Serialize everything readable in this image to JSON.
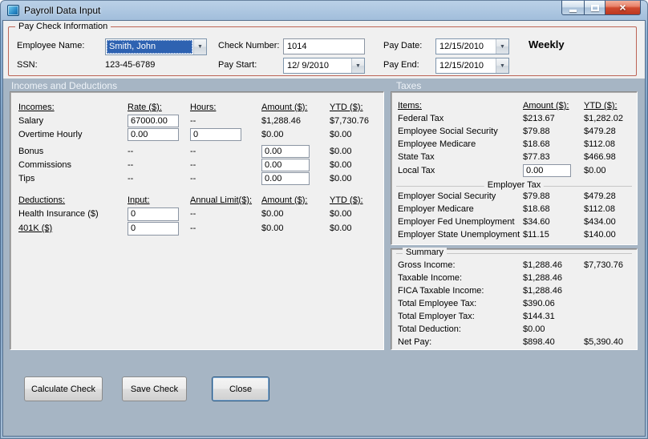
{
  "colors": {
    "selection": "#2e62b1",
    "group_border": "#bc6456",
    "backdrop": "#a6b5c4"
  },
  "icons": {
    "dropdown": "▼"
  },
  "window": {
    "title": "Payroll Data Input"
  },
  "paycheck": {
    "group_label": "Pay Check Information",
    "employee_name_label": "Employee Name:",
    "employee_name_value": "Smith, John",
    "ssn_label": "SSN:",
    "ssn_value": "123-45-6789",
    "check_number_label": "Check Number:",
    "check_number_value": "1014",
    "pay_start_label": "Pay Start:",
    "pay_start_value": "12/ 9/2010",
    "pay_date_label": "Pay Date:",
    "pay_date_value": "12/15/2010",
    "pay_end_label": "Pay End:",
    "pay_end_value": "12/15/2010",
    "frequency": "Weekly"
  },
  "section_headers": {
    "incomes": "Incomes and Deductions",
    "taxes": "Taxes"
  },
  "incomes": {
    "headers": {
      "c1": "Incomes:",
      "c2": "Rate ($):",
      "c3": "Hours:",
      "c4": "Amount ($):",
      "c5": "YTD ($):"
    },
    "salary": {
      "label": "Salary",
      "rate": "67000.00",
      "hours": "--",
      "amount": "$1,288.46",
      "ytd": "$7,730.76"
    },
    "overtime": {
      "label": "Overtime Hourly",
      "rate": "0.00",
      "hours": "0",
      "amount": "$0.00",
      "ytd": "$0.00"
    },
    "bonus": {
      "label": "Bonus",
      "rate": "--",
      "hours": "--",
      "amount": "0.00",
      "ytd": "$0.00"
    },
    "commissions": {
      "label": "Commissions",
      "rate": "--",
      "hours": "--",
      "amount": "0.00",
      "ytd": "$0.00"
    },
    "tips": {
      "label": "Tips",
      "rate": "--",
      "hours": "--",
      "amount": "0.00",
      "ytd": "$0.00"
    }
  },
  "deductions": {
    "headers": {
      "c1": "Deductions:",
      "c2": "Input:",
      "c3": "Annual Limit($):",
      "c4": "Amount ($):",
      "c5": "YTD ($):"
    },
    "health": {
      "label": "Health Insurance ($)",
      "input": "0",
      "limit": "--",
      "amount": "$0.00",
      "ytd": "$0.00"
    },
    "k401": {
      "label": "401K ($)",
      "input": "0",
      "limit": "--",
      "amount": "$0.00",
      "ytd": "$0.00"
    }
  },
  "taxes": {
    "headers": {
      "c1": "Items:",
      "c2": "Amount ($):",
      "c3": "YTD ($):"
    },
    "federal": {
      "label": "Federal Tax",
      "amount": "$213.67",
      "ytd": "$1,282.02"
    },
    "emp_ss": {
      "label": "Employee Social Security",
      "amount": "$79.88",
      "ytd": "$479.28"
    },
    "emp_medicare": {
      "label": "Employee Medicare",
      "amount": "$18.68",
      "ytd": "$112.08"
    },
    "state": {
      "label": "State Tax",
      "amount": "$77.83",
      "ytd": "$466.98"
    },
    "local": {
      "label": "Local Tax",
      "amount": "0.00",
      "ytd": "$0.00"
    },
    "employer_group_label": "Employer Tax",
    "er_ss": {
      "label": "Employer Social Security",
      "amount": "$79.88",
      "ytd": "$479.28"
    },
    "er_medicare": {
      "label": "Employer Medicare",
      "amount": "$18.68",
      "ytd": "$112.08"
    },
    "er_fed_unemp": {
      "label": "Employer Fed Unemployment",
      "amount": "$34.60",
      "ytd": "$434.00"
    },
    "er_state_unemp": {
      "label": "Employer State Unemployment",
      "amount": "$11.15",
      "ytd": "$140.00"
    }
  },
  "summary": {
    "group_label": "Summary",
    "gross": {
      "label": "Gross Income:",
      "amount": "$1,288.46",
      "ytd": "$7,730.76"
    },
    "taxable": {
      "label": "Taxable Income:",
      "amount": "$1,288.46"
    },
    "fica": {
      "label": "FICA Taxable Income:",
      "amount": "$1,288.46"
    },
    "total_emp_tax": {
      "label": "Total Employee Tax:",
      "amount": "$390.06"
    },
    "total_er_tax": {
      "label": "Total Employer Tax:",
      "amount": "$144.31"
    },
    "total_deduction": {
      "label": "Total Deduction:",
      "amount": "$0.00"
    },
    "net_pay": {
      "label": "Net Pay:",
      "amount": "$898.40",
      "ytd": "$5,390.40"
    }
  },
  "buttons": {
    "calculate": "Calculate Check",
    "save": "Save Check",
    "close": "Close"
  }
}
